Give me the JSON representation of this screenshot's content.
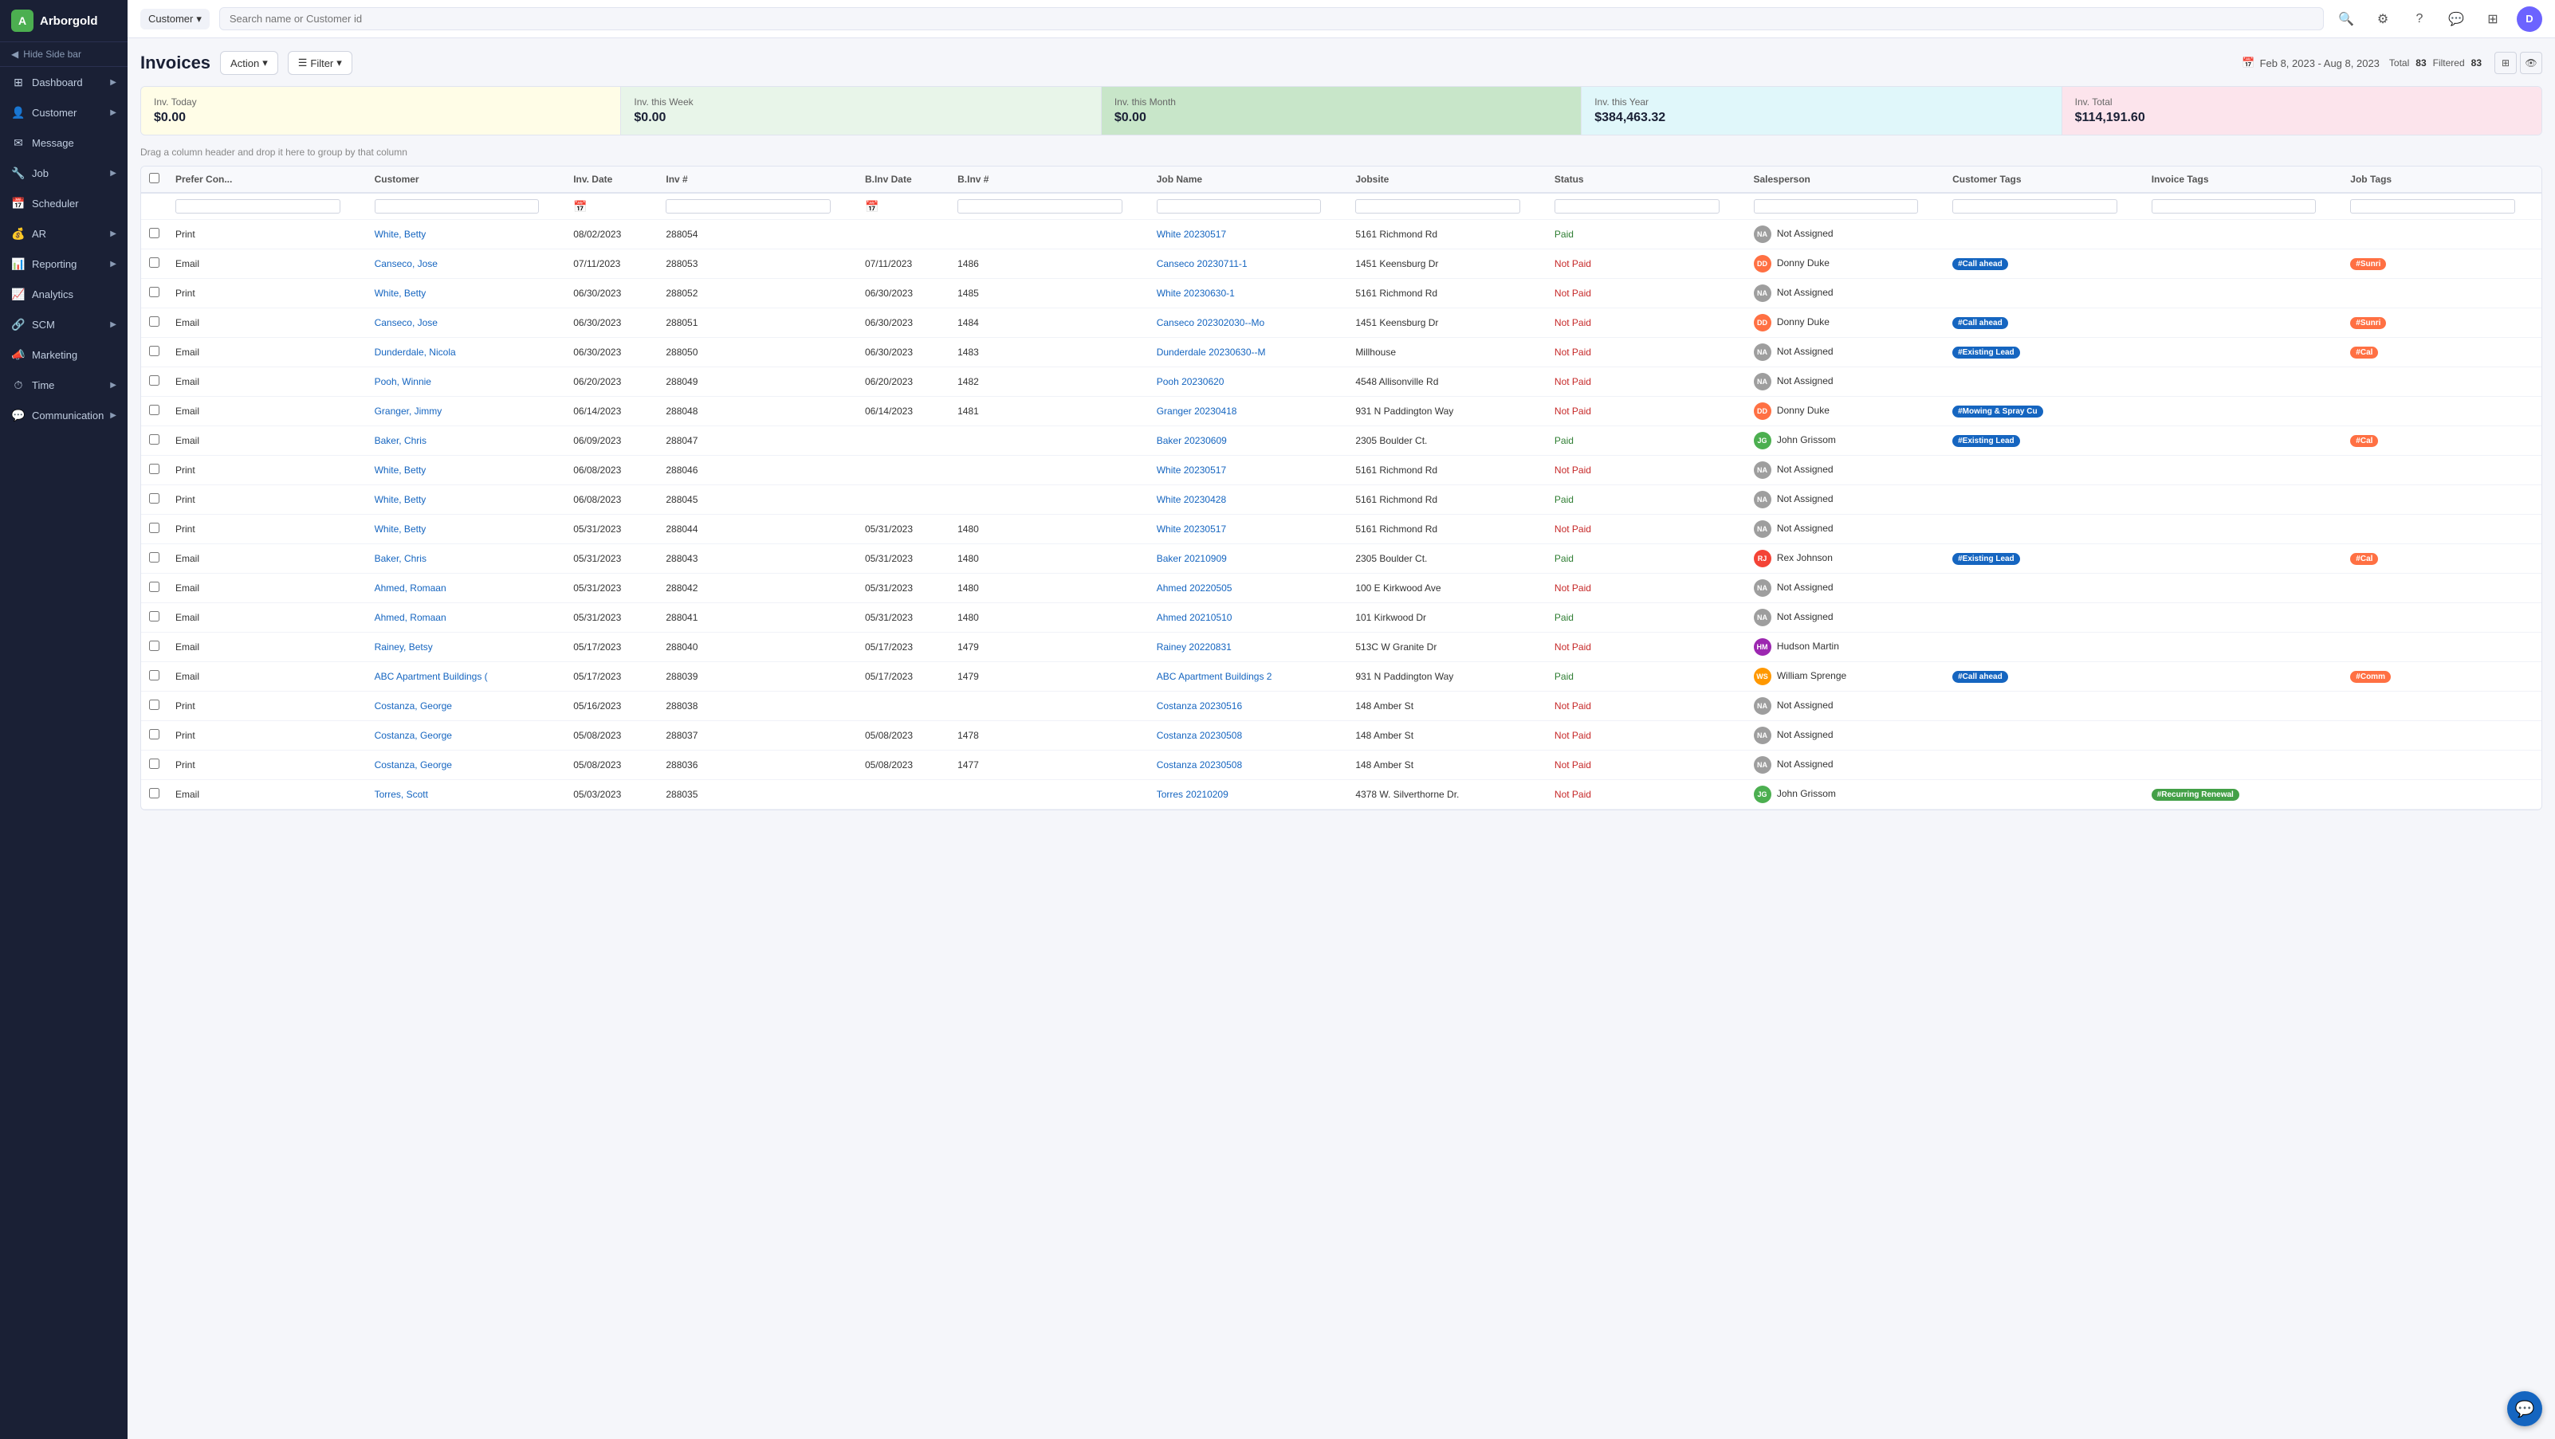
{
  "app": {
    "name": "Arborgold",
    "logo_letter": "A"
  },
  "sidebar": {
    "toggle_label": "Hide Side bar",
    "items": [
      {
        "id": "dashboard",
        "label": "Dashboard",
        "icon": "⊞",
        "has_children": true
      },
      {
        "id": "customer",
        "label": "Customer",
        "icon": "👤",
        "has_children": true
      },
      {
        "id": "message",
        "label": "Message",
        "icon": "✉",
        "has_children": false
      },
      {
        "id": "job",
        "label": "Job",
        "icon": "🔧",
        "has_children": true
      },
      {
        "id": "scheduler",
        "label": "Scheduler",
        "icon": "📅",
        "has_children": false
      },
      {
        "id": "ar",
        "label": "AR",
        "icon": "💰",
        "has_children": true
      },
      {
        "id": "reporting",
        "label": "Reporting",
        "icon": "📊",
        "has_children": true
      },
      {
        "id": "analytics",
        "label": "Analytics",
        "icon": "📈",
        "has_children": false
      },
      {
        "id": "scm",
        "label": "SCM",
        "icon": "🔗",
        "has_children": true
      },
      {
        "id": "marketing",
        "label": "Marketing",
        "icon": "📣",
        "has_children": false
      },
      {
        "id": "time",
        "label": "Time",
        "icon": "⏱",
        "has_children": true
      },
      {
        "id": "communication",
        "label": "Communication",
        "icon": "💬",
        "has_children": true
      }
    ]
  },
  "topbar": {
    "dropdown_label": "Customer",
    "search_placeholder": "Search name or Customer id",
    "avatar_letter": "D"
  },
  "page": {
    "title": "Invoices",
    "action_label": "Action",
    "filter_label": "Filter",
    "date_range": "Feb 8, 2023 - Aug 8, 2023",
    "total_label": "Total",
    "total_count": "83",
    "filtered_label": "Filtered",
    "filtered_count": "83"
  },
  "summary_cards": [
    {
      "label": "Inv. Today",
      "value": "$0.00",
      "class": "card-yellow"
    },
    {
      "label": "Inv. this Week",
      "value": "$0.00",
      "class": "card-light-green"
    },
    {
      "label": "Inv. this Month",
      "value": "$0.00",
      "class": "card-green"
    },
    {
      "label": "Inv. this Year",
      "value": "$384,463.32",
      "class": "card-teal"
    },
    {
      "label": "Inv. Total",
      "value": "$114,191.60",
      "class": "card-pink"
    }
  ],
  "drag_hint": "Drag a column header and drop it here to group by that column",
  "table": {
    "columns": [
      "",
      "Prefer Con...",
      "Customer",
      "Inv. Date",
      "Inv #",
      "B.Inv Date",
      "B.Inv #",
      "Job Name",
      "Jobsite",
      "Status",
      "Salesperson",
      "Customer Tags",
      "Invoice Tags",
      "Job Tags"
    ],
    "rows": [
      {
        "prefer": "Print",
        "customer": "White, Betty",
        "inv_date": "08/02/2023",
        "inv_num": "288054",
        "binv_date": "",
        "binv_num": "",
        "job_name": "White 20230517",
        "jobsite": "5161 Richmond Rd",
        "status": "Paid",
        "salesperson": "Not Assigned",
        "sp_class": "sp-na",
        "sp_initials": "NA",
        "customer_tags": [],
        "invoice_tags": [],
        "job_tags": []
      },
      {
        "prefer": "Email",
        "customer": "Canseco, Jose",
        "inv_date": "07/11/2023",
        "inv_num": "288053",
        "binv_date": "07/11/2023",
        "binv_num": "1486",
        "job_name": "Canseco 20230711-1",
        "jobsite": "1451 Keensburg Dr",
        "status": "Not Paid",
        "salesperson": "Donny Duke",
        "sp_class": "sp-dd",
        "sp_initials": "DD",
        "customer_tags": [
          "#Call ahead"
        ],
        "invoice_tags": [],
        "job_tags": [
          "#Sunri"
        ]
      },
      {
        "prefer": "Print",
        "customer": "White, Betty",
        "inv_date": "06/30/2023",
        "inv_num": "288052",
        "binv_date": "06/30/2023",
        "binv_num": "1485",
        "job_name": "White 20230630-1",
        "jobsite": "5161 Richmond Rd",
        "status": "Not Paid",
        "salesperson": "Not Assigned",
        "sp_class": "sp-na",
        "sp_initials": "NA",
        "customer_tags": [],
        "invoice_tags": [],
        "job_tags": []
      },
      {
        "prefer": "Email",
        "customer": "Canseco, Jose",
        "inv_date": "06/30/2023",
        "inv_num": "288051",
        "binv_date": "06/30/2023",
        "binv_num": "1484",
        "job_name": "Canseco 202302030--Mo",
        "jobsite": "1451 Keensburg Dr",
        "status": "Not Paid",
        "salesperson": "Donny Duke",
        "sp_class": "sp-dd",
        "sp_initials": "DD",
        "customer_tags": [
          "#Call ahead"
        ],
        "invoice_tags": [],
        "job_tags": [
          "#Sunri"
        ]
      },
      {
        "prefer": "Email",
        "customer": "Dunderdale, Nicola",
        "inv_date": "06/30/2023",
        "inv_num": "288050",
        "binv_date": "06/30/2023",
        "binv_num": "1483",
        "job_name": "Dunderdale 20230630--M",
        "jobsite": "Millhouse",
        "status": "Not Paid",
        "salesperson": "Not Assigned",
        "sp_class": "sp-na",
        "sp_initials": "NA",
        "customer_tags": [
          "#Existing Lead"
        ],
        "invoice_tags": [],
        "job_tags": [
          "#Cal"
        ]
      },
      {
        "prefer": "Email",
        "customer": "Pooh, Winnie",
        "inv_date": "06/20/2023",
        "inv_num": "288049",
        "binv_date": "06/20/2023",
        "binv_num": "1482",
        "job_name": "Pooh 20230620",
        "jobsite": "4548 Allisonville Rd",
        "status": "Not Paid",
        "salesperson": "Not Assigned",
        "sp_class": "sp-na",
        "sp_initials": "NA",
        "customer_tags": [],
        "invoice_tags": [],
        "job_tags": []
      },
      {
        "prefer": "Email",
        "customer": "Granger, Jimmy",
        "inv_date": "06/14/2023",
        "inv_num": "288048",
        "binv_date": "06/14/2023",
        "binv_num": "1481",
        "job_name": "Granger 20230418",
        "jobsite": "931 N Paddington Way",
        "status": "Not Paid",
        "salesperson": "Donny Duke",
        "sp_class": "sp-dd",
        "sp_initials": "DD",
        "customer_tags": [
          "#Mowing &amp; Spray Cu"
        ],
        "invoice_tags": [],
        "job_tags": []
      },
      {
        "prefer": "Email",
        "customer": "Baker, Chris",
        "inv_date": "06/09/2023",
        "inv_num": "288047",
        "binv_date": "",
        "binv_num": "",
        "job_name": "Baker 20230609",
        "jobsite": "2305 Boulder Ct.",
        "status": "Paid",
        "salesperson": "John Grissom",
        "sp_class": "sp-jg",
        "sp_initials": "JG",
        "customer_tags": [
          "#Existing Lead"
        ],
        "invoice_tags": [],
        "job_tags": [
          "#Cal"
        ]
      },
      {
        "prefer": "Print",
        "customer": "White, Betty",
        "inv_date": "06/08/2023",
        "inv_num": "288046",
        "binv_date": "",
        "binv_num": "",
        "job_name": "White 20230517",
        "jobsite": "5161 Richmond Rd",
        "status": "Not Paid",
        "salesperson": "Not Assigned",
        "sp_class": "sp-na",
        "sp_initials": "NA",
        "customer_tags": [],
        "invoice_tags": [],
        "job_tags": []
      },
      {
        "prefer": "Print",
        "customer": "White, Betty",
        "inv_date": "06/08/2023",
        "inv_num": "288045",
        "binv_date": "",
        "binv_num": "",
        "job_name": "White 20230428",
        "jobsite": "5161 Richmond Rd",
        "status": "Paid",
        "salesperson": "Not Assigned",
        "sp_class": "sp-na",
        "sp_initials": "NA",
        "customer_tags": [],
        "invoice_tags": [],
        "job_tags": []
      },
      {
        "prefer": "Print",
        "customer": "White, Betty",
        "inv_date": "05/31/2023",
        "inv_num": "288044",
        "binv_date": "05/31/2023",
        "binv_num": "1480",
        "job_name": "White 20230517",
        "jobsite": "5161 Richmond Rd",
        "status": "Not Paid",
        "salesperson": "Not Assigned",
        "sp_class": "sp-na",
        "sp_initials": "NA",
        "customer_tags": [],
        "invoice_tags": [],
        "job_tags": []
      },
      {
        "prefer": "Email",
        "customer": "Baker, Chris",
        "inv_date": "05/31/2023",
        "inv_num": "288043",
        "binv_date": "05/31/2023",
        "binv_num": "1480",
        "job_name": "Baker 20210909",
        "jobsite": "2305 Boulder Ct.",
        "status": "Paid",
        "salesperson": "Rex Johnson",
        "sp_class": "sp-rj",
        "sp_initials": "RJ",
        "customer_tags": [
          "#Existing Lead"
        ],
        "invoice_tags": [],
        "job_tags": [
          "#Cal"
        ]
      },
      {
        "prefer": "Email",
        "customer": "Ahmed, Romaan",
        "inv_date": "05/31/2023",
        "inv_num": "288042",
        "binv_date": "05/31/2023",
        "binv_num": "1480",
        "job_name": "Ahmed 20220505",
        "jobsite": "100 E Kirkwood Ave",
        "status": "Not Paid",
        "salesperson": "Not Assigned",
        "sp_class": "sp-na",
        "sp_initials": "NA",
        "customer_tags": [],
        "invoice_tags": [],
        "job_tags": []
      },
      {
        "prefer": "Email",
        "customer": "Ahmed, Romaan",
        "inv_date": "05/31/2023",
        "inv_num": "288041",
        "binv_date": "05/31/2023",
        "binv_num": "1480",
        "job_name": "Ahmed 20210510",
        "jobsite": "101 Kirkwood Dr",
        "status": "Paid",
        "salesperson": "Not Assigned",
        "sp_class": "sp-na",
        "sp_initials": "NA",
        "customer_tags": [],
        "invoice_tags": [],
        "job_tags": []
      },
      {
        "prefer": "Email",
        "customer": "Rainey, Betsy",
        "inv_date": "05/17/2023",
        "inv_num": "288040",
        "binv_date": "05/17/2023",
        "binv_num": "1479",
        "job_name": "Rainey 20220831",
        "jobsite": "513C W Granite Dr",
        "status": "Not Paid",
        "salesperson": "Hudson Martin",
        "sp_class": "sp-hm",
        "sp_initials": "HM",
        "customer_tags": [],
        "invoice_tags": [],
        "job_tags": []
      },
      {
        "prefer": "Email",
        "customer": "ABC Apartment Buildings (",
        "inv_date": "05/17/2023",
        "inv_num": "288039",
        "binv_date": "05/17/2023",
        "binv_num": "1479",
        "job_name": "ABC Apartment Buildings 2",
        "jobsite": "931 N Paddington Way",
        "status": "Paid",
        "salesperson": "William Sprenge",
        "sp_class": "sp-ws",
        "sp_initials": "WS",
        "customer_tags": [
          "#Call ahead"
        ],
        "invoice_tags": [],
        "job_tags": [
          "#Comm"
        ]
      },
      {
        "prefer": "Print",
        "customer": "Costanza, George",
        "inv_date": "05/16/2023",
        "inv_num": "288038",
        "binv_date": "",
        "binv_num": "",
        "job_name": "Costanza 20230516",
        "jobsite": "148 Amber St",
        "status": "Not Paid",
        "salesperson": "Not Assigned",
        "sp_class": "sp-na",
        "sp_initials": "NA",
        "customer_tags": [],
        "invoice_tags": [],
        "job_tags": []
      },
      {
        "prefer": "Print",
        "customer": "Costanza, George",
        "inv_date": "05/08/2023",
        "inv_num": "288037",
        "binv_date": "05/08/2023",
        "binv_num": "1478",
        "job_name": "Costanza 20230508",
        "jobsite": "148 Amber St",
        "status": "Not Paid",
        "salesperson": "Not Assigned",
        "sp_class": "sp-na",
        "sp_initials": "NA",
        "customer_tags": [],
        "invoice_tags": [],
        "job_tags": []
      },
      {
        "prefer": "Print",
        "customer": "Costanza, George",
        "inv_date": "05/08/2023",
        "inv_num": "288036",
        "binv_date": "05/08/2023",
        "binv_num": "1477",
        "job_name": "Costanza 20230508",
        "jobsite": "148 Amber St",
        "status": "Not Paid",
        "salesperson": "Not Assigned",
        "sp_class": "sp-na",
        "sp_initials": "NA",
        "customer_tags": [],
        "invoice_tags": [],
        "job_tags": []
      },
      {
        "prefer": "Email",
        "customer": "Torres, Scott",
        "inv_date": "05/03/2023",
        "inv_num": "288035",
        "binv_date": "",
        "binv_num": "",
        "job_name": "Torres 20210209",
        "jobsite": "4378 W. Silverthorne Dr.",
        "status": "Not Paid",
        "salesperson": "John Grissom",
        "sp_class": "sp-jg",
        "sp_initials": "JG",
        "customer_tags": [],
        "invoice_tags": [
          "#Recurring Renewal"
        ],
        "job_tags": []
      }
    ]
  }
}
